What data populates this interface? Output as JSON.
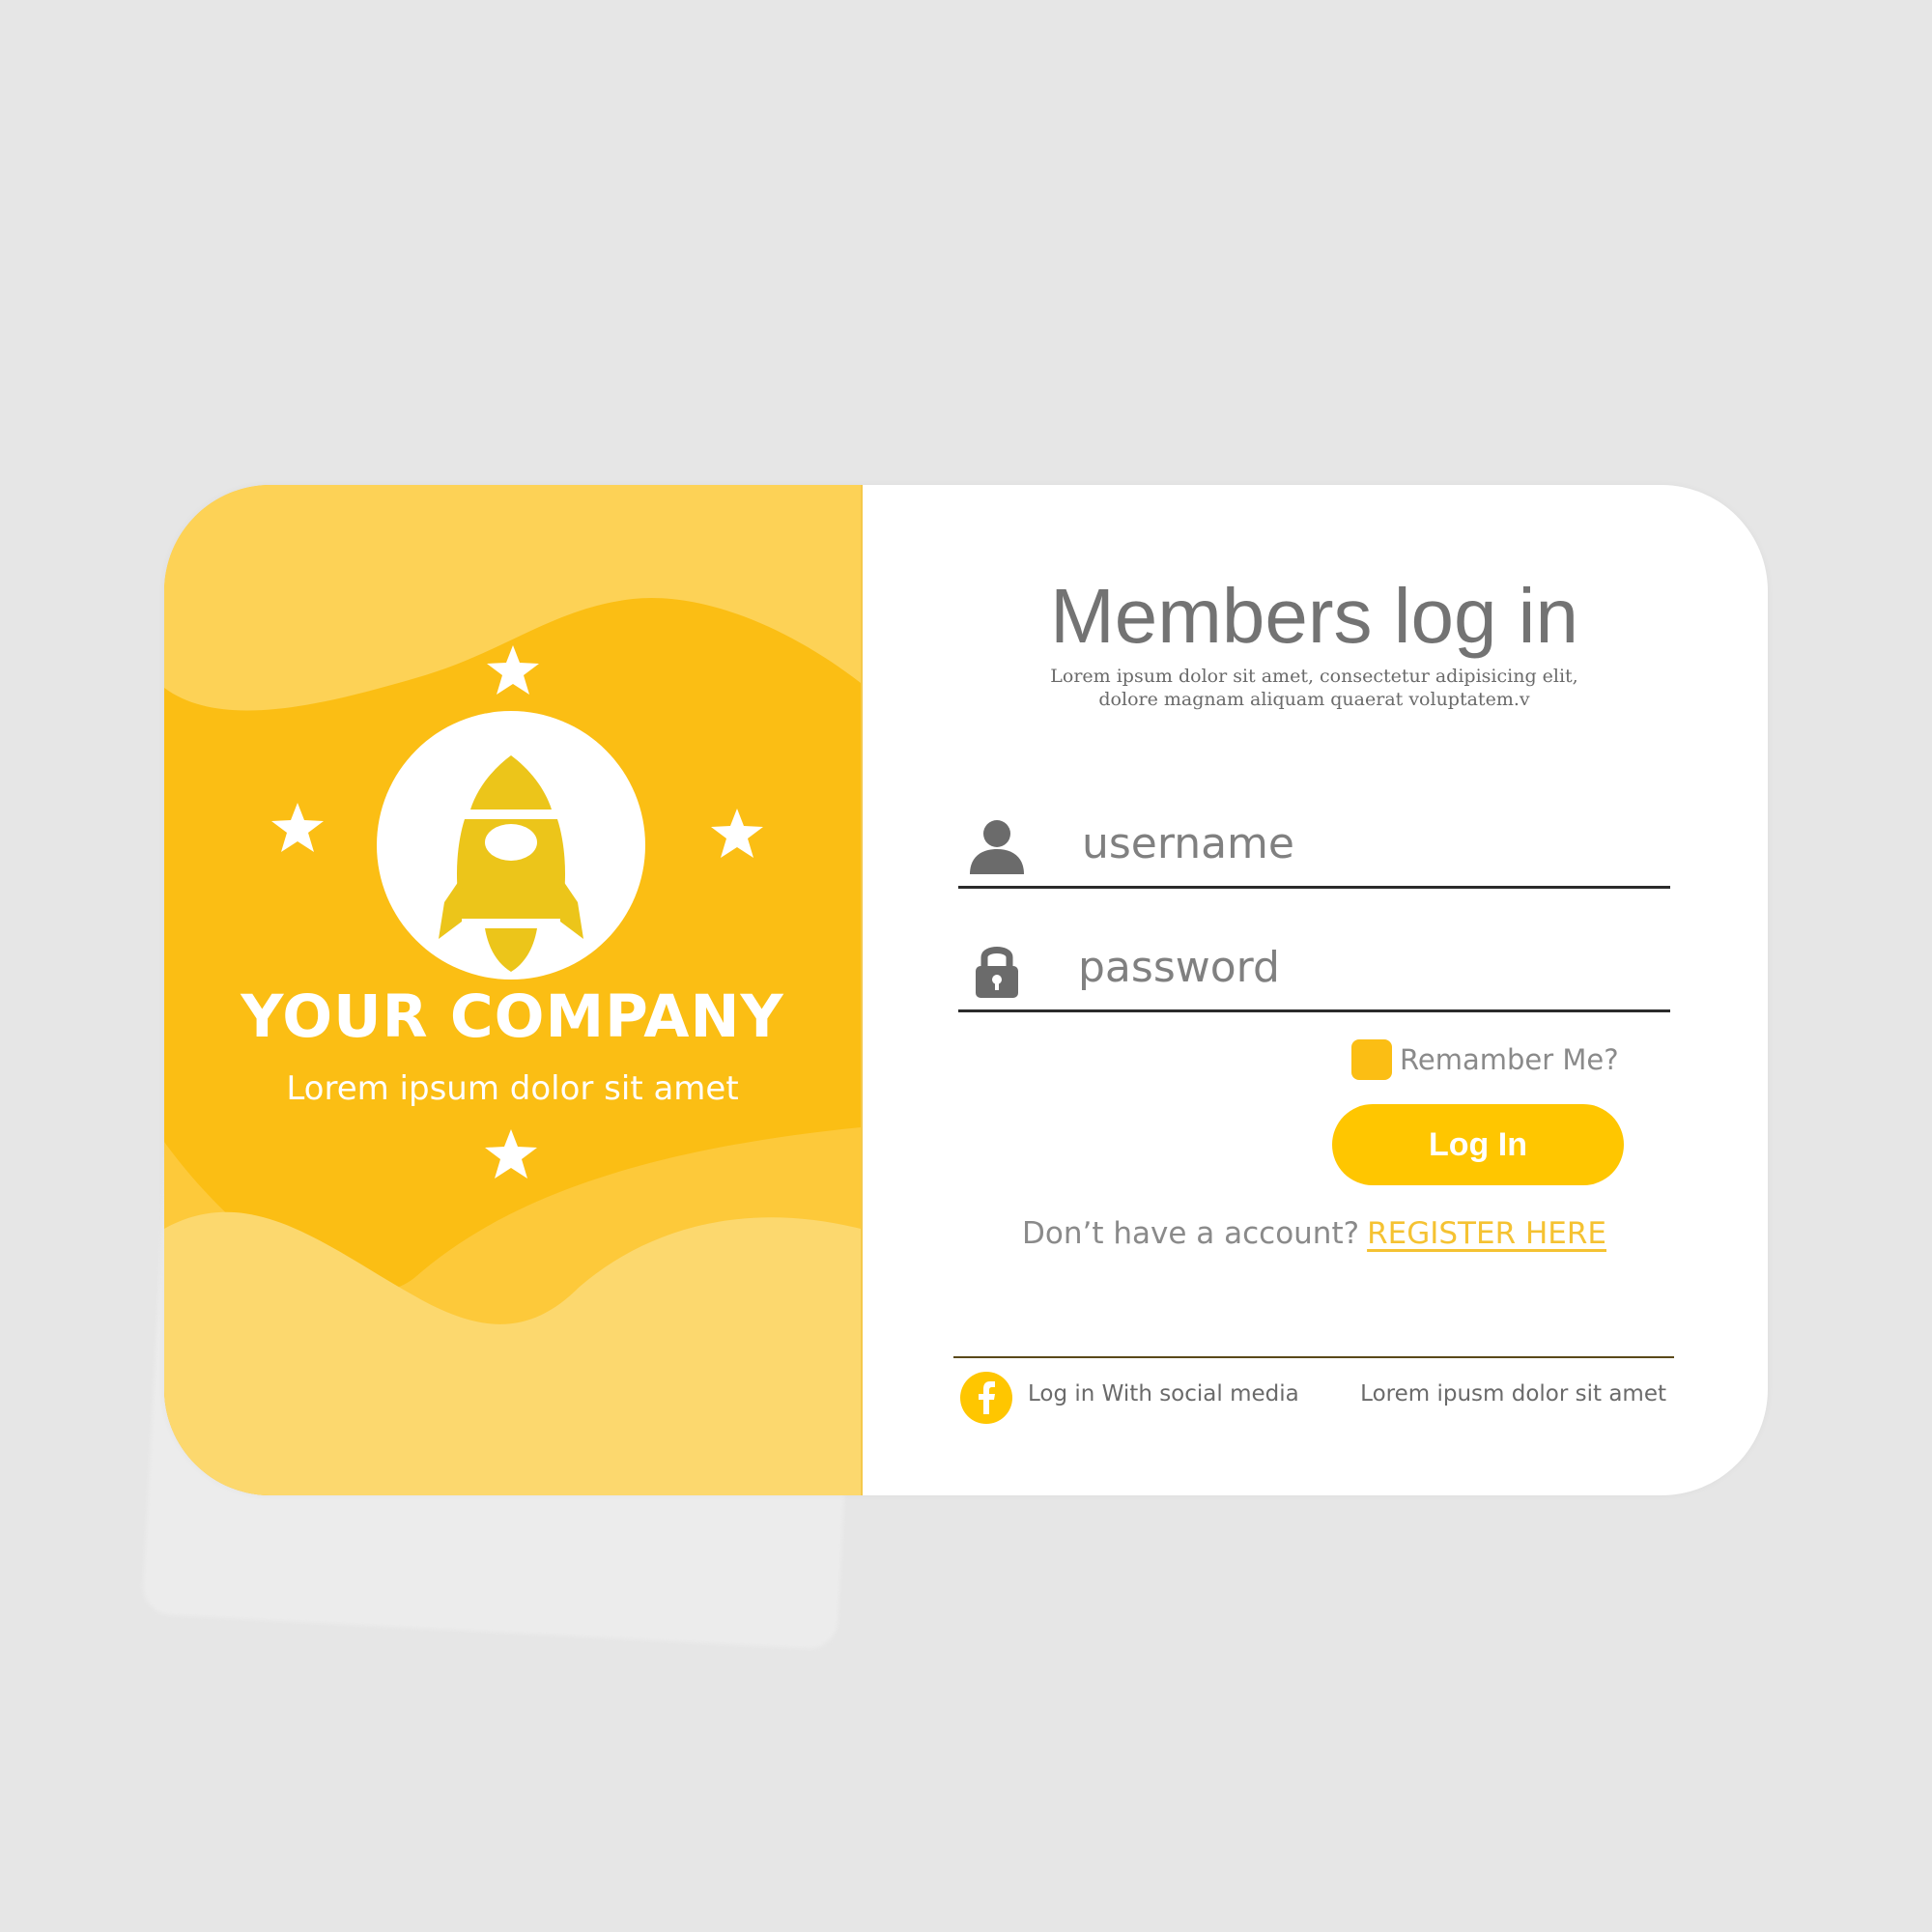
{
  "brand": {
    "company_name": "YOUR COMPANY",
    "tagline": "Lorem ipsum dolor sit amet",
    "logo_icon": "rocket-icon",
    "decor_icon": "star-icon",
    "colors": {
      "primary": "#fbbe14",
      "button": "#ffc600",
      "light_wave": "#fcd86e"
    }
  },
  "login": {
    "title": "Members log in",
    "subtitle_line1": "Lorem ipsum dolor sit amet, consectetur adipisicing elit,",
    "subtitle_line2": "dolore magnam aliquam quaerat voluptatem.v",
    "username": {
      "icon": "user-icon",
      "placeholder": "username",
      "value": ""
    },
    "password": {
      "icon": "lock-icon",
      "placeholder": "password",
      "value": ""
    },
    "remember_label": "Remamber Me?",
    "submit_label": "Log In",
    "register_prompt": "Don’t have a account?",
    "register_link": "REGISTER HERE",
    "social": {
      "icon": "facebook-icon",
      "label": "Log in With social media"
    },
    "footer_note": "Lorem ipusm dolor sit amet"
  }
}
